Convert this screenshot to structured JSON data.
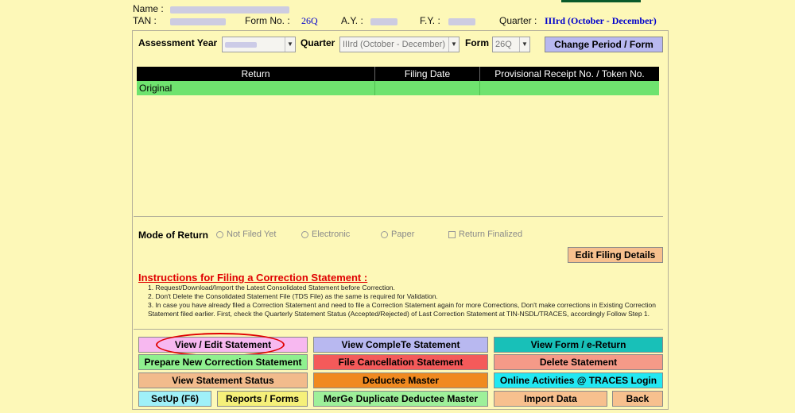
{
  "header": {
    "name_label": "Name :",
    "tan_label": "TAN :",
    "form_no_label": "Form No. :",
    "form_no_value": "26Q",
    "ay_label": "A.Y. :",
    "fy_label": "F.Y. :",
    "quarter_label": "Quarter :",
    "quarter_value": "IIIrd (October - December)"
  },
  "period": {
    "assessment_year_label": "Assessment Year",
    "quarter_label": "Quarter",
    "quarter_value": "IIIrd (October - December)",
    "form_label": "Form",
    "form_value": "26Q",
    "change_button": "Change Period / Form"
  },
  "table": {
    "columns": [
      "Return",
      "Filing Date",
      "Provisional Receipt No. / Token No."
    ],
    "rows": [
      [
        "Original",
        "",
        ""
      ]
    ]
  },
  "mode": {
    "label": "Mode of Return",
    "options": [
      "Not Filed Yet",
      "Electronic",
      "Paper"
    ],
    "finalized": "Return Finalized",
    "edit_button": "Edit Filing Details"
  },
  "instructions": {
    "title": "Instructions for Filing a Correction Statement :",
    "lines": [
      "1. Request/Download/Import the Latest Consolidated Statement before Correction.",
      "2. Don't Delete the Consolidated Statement File (TDS File) as the same is required for Validation.",
      "3. In case you have already filed a Correction Statement and need to file a Correction Statement again for more Corrections, Don't make corrections in Existing Correction",
      "Statement filed earlier. First, check the Quarterly Statement Status (Accepted/Rejected) of Last Correction Statement at TIN-NSDL/TRACES, accordingly Follow Step 1."
    ]
  },
  "actions": {
    "view_edit": "View / Edit Statement",
    "view_complete": "View CompleTe Statement",
    "view_form": "View Form / e-Return",
    "prepare_correction": "Prepare New Correction Statement",
    "file_cancellation": "File Cancellation Statement",
    "delete_statement": "Delete Statement",
    "view_status": "View Statement Status",
    "deductee_master": "Deductee Master",
    "online_activities": "Online Activities @ TRACES Login",
    "setup": "SetUp (F6)",
    "reports": "Reports / Forms",
    "merge_duplicate": "MerGe Duplicate Deductee Master",
    "import_data": "Import Data",
    "back": "Back"
  },
  "colors": {
    "background": "#fdf8b8",
    "header_value": "#0000cc",
    "table_header": "#000000",
    "row_selected": "#6fe36f",
    "instruction_title": "#e00000"
  }
}
